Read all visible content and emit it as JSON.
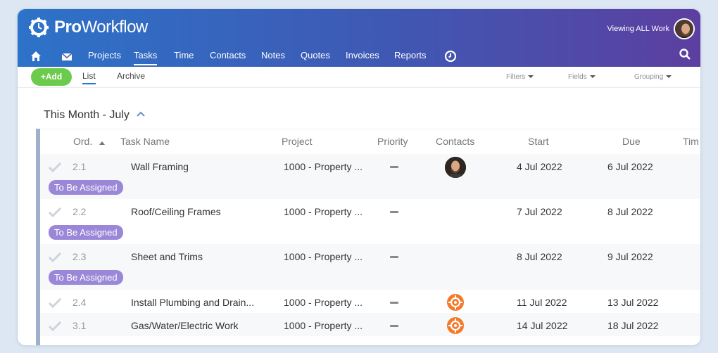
{
  "app": {
    "logo_bold": "Pro",
    "logo_rest": "Workflow",
    "viewing": "Viewing ALL Work"
  },
  "nav": {
    "items": [
      "Projects",
      "Tasks",
      "Time",
      "Contacts",
      "Notes",
      "Quotes",
      "Invoices",
      "Reports"
    ],
    "active": "Tasks"
  },
  "toolbar": {
    "add_label": "Add",
    "tabs": [
      "List",
      "Archive"
    ],
    "filters": "Filters",
    "fields": "Fields",
    "grouping": "Grouping"
  },
  "group": {
    "title": "This Month - July"
  },
  "table": {
    "headers": {
      "ord": "Ord.",
      "task": "Task Name",
      "project": "Project",
      "priority": "Priority",
      "contacts": "Contacts",
      "start": "Start",
      "due": "Due",
      "time": "Tim"
    },
    "rows": [
      {
        "ord": "2.1",
        "task": "Wall Framing",
        "project": "1000 - Property ...",
        "start": "4 Jul 2022",
        "due": "6 Jul 2022",
        "badge": "To Be Assigned",
        "contact": "person"
      },
      {
        "ord": "2.2",
        "task": "Roof/Ceiling Frames",
        "project": "1000 - Property ...",
        "start": "7 Jul 2022",
        "due": "8 Jul 2022",
        "badge": "To Be Assigned",
        "contact": "none"
      },
      {
        "ord": "2.3",
        "task": "Sheet and Trims",
        "project": "1000 - Property ...",
        "start": "8 Jul 2022",
        "due": "9 Jul 2022",
        "badge": "To Be Assigned",
        "contact": "none"
      },
      {
        "ord": "2.4",
        "task": "Install Plumbing and Drain...",
        "project": "1000 - Property ...",
        "start": "11 Jul 2022",
        "due": "13 Jul 2022",
        "badge": "",
        "contact": "company"
      },
      {
        "ord": "3.1",
        "task": "Gas/Water/Electric Work",
        "project": "1000 - Property ...",
        "start": "14 Jul 2022",
        "due": "18 Jul 2022",
        "badge": "",
        "contact": "company"
      }
    ]
  },
  "colors": {
    "accent": "#2d73c9",
    "add_green": "#6ccb4c",
    "badge_purple": "#9b87d8",
    "contact_orange": "#f47a2a"
  }
}
